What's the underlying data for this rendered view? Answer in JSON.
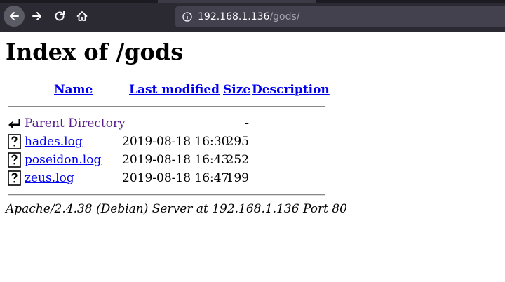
{
  "browser": {
    "url_host": "192.168.1.136",
    "url_path": "/gods/"
  },
  "page": {
    "title": "Index of /gods",
    "columns": {
      "name": "Name",
      "last_modified": "Last modified",
      "size": "Size",
      "description": "Description"
    },
    "parent": {
      "name": "Parent Directory",
      "size": "-"
    },
    "files": [
      {
        "name": "hades.log",
        "modified": "2019-08-18 16:30",
        "size": "295"
      },
      {
        "name": "poseidon.log",
        "modified": "2019-08-18 16:43",
        "size": "252"
      },
      {
        "name": "zeus.log",
        "modified": "2019-08-18 16:47",
        "size": "199"
      }
    ],
    "address": "Apache/2.4.38 (Debian) Server at 192.168.1.136 Port 80"
  },
  "colors": {
    "toolbar": "#2b2a33",
    "urlbar": "#42414d",
    "link": "#0000ee",
    "visited": "#551a8b"
  },
  "icons": {
    "back": "arrow-left-icon",
    "forward": "arrow-right-icon",
    "reload": "reload-icon",
    "home": "home-icon",
    "site_info": "info-icon",
    "parent": "back-arrow-folder-icon",
    "file": "unknown-file-icon"
  }
}
